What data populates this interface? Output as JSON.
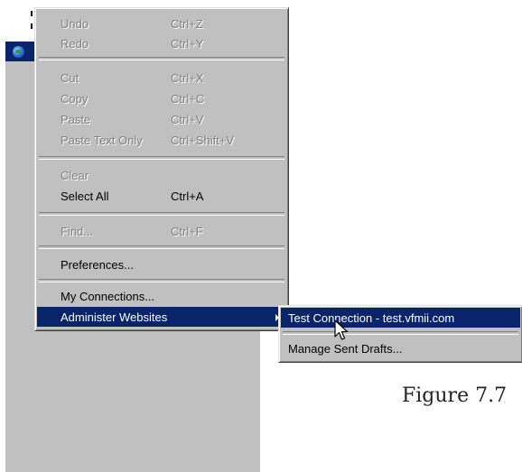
{
  "main_menu": {
    "items": [
      {
        "label": "Undo",
        "shortcut": "Ctrl+Z",
        "enabled": false
      },
      {
        "label": "Redo",
        "shortcut": "Ctrl+Y",
        "enabled": false
      },
      {
        "label": "Cut",
        "shortcut": "Ctrl+X",
        "enabled": false
      },
      {
        "label": "Copy",
        "shortcut": "Ctrl+C",
        "enabled": false
      },
      {
        "label": "Paste",
        "shortcut": "Ctrl+V",
        "enabled": false
      },
      {
        "label": "Paste Text Only",
        "shortcut": "Ctrl+Shift+V",
        "enabled": false
      },
      {
        "label": "Clear",
        "shortcut": "",
        "enabled": false
      },
      {
        "label": "Select All",
        "shortcut": "Ctrl+A",
        "enabled": true
      },
      {
        "label": "Find...",
        "shortcut": "Ctrl+F",
        "enabled": false
      },
      {
        "label": "Preferences...",
        "shortcut": "",
        "enabled": true
      },
      {
        "label": "My Connections...",
        "shortcut": "",
        "enabled": true
      },
      {
        "label": "Administer Websites",
        "shortcut": "",
        "enabled": true,
        "highlighted": true,
        "has_submenu": true
      }
    ]
  },
  "submenu": {
    "items": [
      {
        "label": "Test Connection - test.vfmii.com",
        "highlighted": true
      },
      {
        "label": "Manage Sent Drafts..."
      }
    ]
  },
  "caption": "Figure 7.7",
  "colors": {
    "menu_bg": "#c0c0c0",
    "highlight": "#0a246a",
    "disabled_text": "#808080"
  },
  "icons": [
    "globe-icon",
    "submenu-arrow-icon",
    "mouse-pointer-icon"
  ]
}
